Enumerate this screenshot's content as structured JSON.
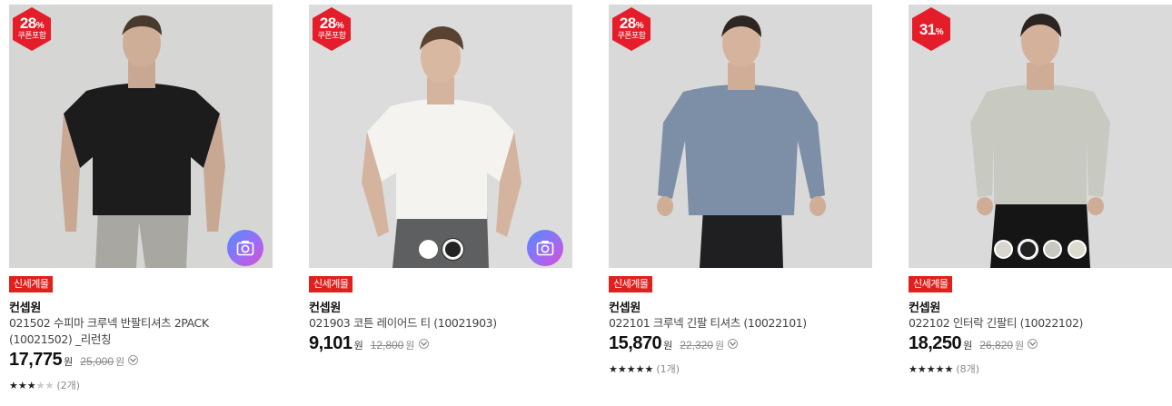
{
  "colors": {
    "discount_badge": "#e51d2a",
    "tag_red": "#e0201b",
    "camera_gradient": [
      "#4f8dfb",
      "#9b6cf5",
      "#d84fd0"
    ]
  },
  "products": [
    {
      "badge_pct": "28",
      "badge_unit": "%",
      "badge_sub": "쿠폰포함",
      "tag": "신세계몰",
      "brand": "컨셉원",
      "name": "021502 수피마 크루넥 반팔티셔츠 2PACK (10021502) _리런칭",
      "price": "17,775",
      "price_unit": "원",
      "original_price": "25,000",
      "original_unit": "원",
      "rating": 3,
      "review_count": "(2개)",
      "has_camera": true,
      "swatches": []
    },
    {
      "badge_pct": "28",
      "badge_unit": "%",
      "badge_sub": "쿠폰포함",
      "tag": "신세계몰",
      "brand": "컨셉원",
      "name": "021903 코튼 레이어드 티 (10021903)",
      "price": "9,101",
      "price_unit": "원",
      "original_price": "12,800",
      "original_unit": "원",
      "rating": null,
      "review_count": "",
      "has_camera": true,
      "swatches": [
        "#ffffff",
        "#222222"
      ]
    },
    {
      "badge_pct": "28",
      "badge_unit": "%",
      "badge_sub": "쿠폰포함",
      "tag": "신세계몰",
      "brand": "컨셉원",
      "name": "022101 크루넥 긴팔 티셔츠 (10022101)",
      "price": "15,870",
      "price_unit": "원",
      "original_price": "22,320",
      "original_unit": "원",
      "rating": 5,
      "review_count": "(1개)",
      "has_camera": false,
      "swatches": []
    },
    {
      "badge_pct": "31",
      "badge_unit": "%",
      "badge_sub": "",
      "tag": "신세계몰",
      "brand": "컨셉원",
      "name": "022102 인터락 긴팔티 (10022102)",
      "price": "18,250",
      "price_unit": "원",
      "original_price": "26,820",
      "original_unit": "원",
      "rating": 5,
      "review_count": "(8개)",
      "has_camera": false,
      "swatches": [
        "#d8d6cf",
        "#222222",
        "#c7c8c0",
        "#dedbcf"
      ]
    }
  ]
}
